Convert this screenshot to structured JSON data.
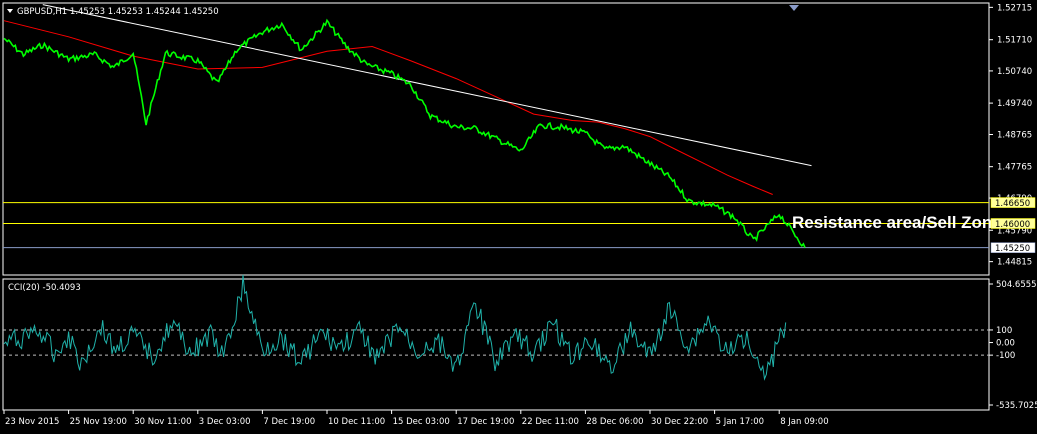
{
  "window": {
    "symbol_header": "GBPUSD,H1  1.45253 1.45253 1.45244 1.45250",
    "indicator_header": "CCI(20) -50.4093"
  },
  "colors": {
    "background": "#000000",
    "frame": "#ffffff",
    "price_line": "#00ff00",
    "moving_average": "#ff0000",
    "trendline": "#ffffff",
    "zone_line": "#ffff00",
    "bid_line": "#8a9bc8",
    "cci_line": "#20b2aa",
    "level_line": "#c0c0c0",
    "price_tag_fill": "#ffff99"
  },
  "chart_data": [
    {
      "type": "line",
      "title": "GBPUSD,H1",
      "ylim": [
        1.444,
        1.5285
      ],
      "yticks": [
        "1.52715",
        "1.51710",
        "1.50740",
        "1.49740",
        "1.48765",
        "1.47765",
        "1.46790",
        "1.45790",
        "1.44815"
      ],
      "xticks": [
        "23 Nov 2015",
        "25 Nov 19:00",
        "30 Nov 11:00",
        "3 Dec 03:00",
        "7 Dec 19:00",
        "10 Dec 11:00",
        "15 Dec 03:00",
        "17 Dec 19:00",
        "22 Dec 11:00",
        "28 Dec 06:00",
        "30 Dec 22:00",
        "5 Jan 17:00",
        "8 Jan 09:00"
      ],
      "series": [
        {
          "role": "price",
          "x": [
            0,
            0.3,
            0.6,
            1,
            1.4,
            1.7,
            2,
            2.2,
            2.5,
            2.8,
            3,
            3.3,
            3.6,
            4,
            4.3,
            4.6,
            5,
            5.3,
            5.6,
            6,
            6.3,
            6.6,
            7,
            7.3,
            7.6,
            8,
            8.3,
            8.6,
            9,
            9.3,
            9.6,
            10,
            10.3,
            10.6,
            11,
            11.3,
            11.6,
            12,
            12.4
          ],
          "values": [
            1.5175,
            1.5125,
            1.5155,
            1.511,
            1.5125,
            1.5085,
            1.513,
            1.491,
            1.513,
            1.5115,
            1.5105,
            1.5035,
            1.514,
            1.5195,
            1.522,
            1.514,
            1.5225,
            1.515,
            1.5095,
            1.5065,
            1.503,
            1.4935,
            1.49,
            1.4895,
            1.4865,
            1.4825,
            1.4905,
            1.49,
            1.488,
            1.483,
            1.484,
            1.4785,
            1.4745,
            1.467,
            1.4655,
            1.462,
            1.4548,
            1.463,
            1.4525
          ]
        },
        {
          "role": "moving_average",
          "x": [
            0,
            1,
            2,
            3,
            4,
            5,
            5.7,
            6.3,
            7,
            7.6,
            8.2,
            8.8,
            9.2,
            9.6,
            10,
            10.4,
            10.8,
            11.2,
            11.6,
            11.9
          ],
          "values": [
            1.523,
            1.518,
            1.512,
            1.508,
            1.5085,
            1.5135,
            1.515,
            1.5105,
            1.505,
            1.4995,
            1.494,
            1.492,
            1.4915,
            1.4895,
            1.487,
            1.483,
            1.479,
            1.475,
            1.4715,
            1.469
          ]
        },
        {
          "role": "trendline",
          "x": [
            0.6,
            12.5
          ],
          "values": [
            1.528,
            1.478
          ]
        }
      ],
      "levels": [
        {
          "value": 1.4665,
          "label": "1.46650",
          "role": "zone_line"
        },
        {
          "value": 1.46,
          "label": "1.46000",
          "role": "zone_line"
        },
        {
          "value": 1.4525,
          "label": "1.45250",
          "role": "bid_line"
        }
      ],
      "annotation": "Resistance area/Sell Zone"
    },
    {
      "type": "line",
      "title": "CCI(20) -50.4093",
      "ylim": [
        -535.7025,
        504.6555
      ],
      "yticks": [
        "504.6555",
        "100",
        "0.00",
        "-100",
        "-535.7025"
      ],
      "levels": [
        100,
        -100
      ],
      "series": [
        {
          "role": "cci",
          "x": [
            0,
            0.3,
            0.5,
            0.8,
            1,
            1.2,
            1.5,
            1.7,
            2,
            2.3,
            2.6,
            2.9,
            3.2,
            3.4,
            3.7,
            4,
            4.3,
            4.6,
            4.9,
            5.2,
            5.5,
            5.8,
            6.1,
            6.4,
            6.7,
            7,
            7.3,
            7.6,
            7.9,
            8.2,
            8.5,
            8.8,
            9.1,
            9.4,
            9.7,
            10,
            10.3,
            10.6,
            10.9,
            11.2,
            11.5,
            11.8,
            12.1
          ],
          "values": [
            -10,
            40,
            110,
            -90,
            60,
            -170,
            130,
            -60,
            60,
            -110,
            150,
            -80,
            60,
            -130,
            450,
            -60,
            40,
            -150,
            70,
            -40,
            80,
            -130,
            130,
            -80,
            20,
            -190,
            300,
            -140,
            60,
            -80,
            150,
            -110,
            30,
            -200,
            90,
            -120,
            260,
            -40,
            180,
            -100,
            70,
            -260,
            160
          ]
        }
      ]
    }
  ]
}
